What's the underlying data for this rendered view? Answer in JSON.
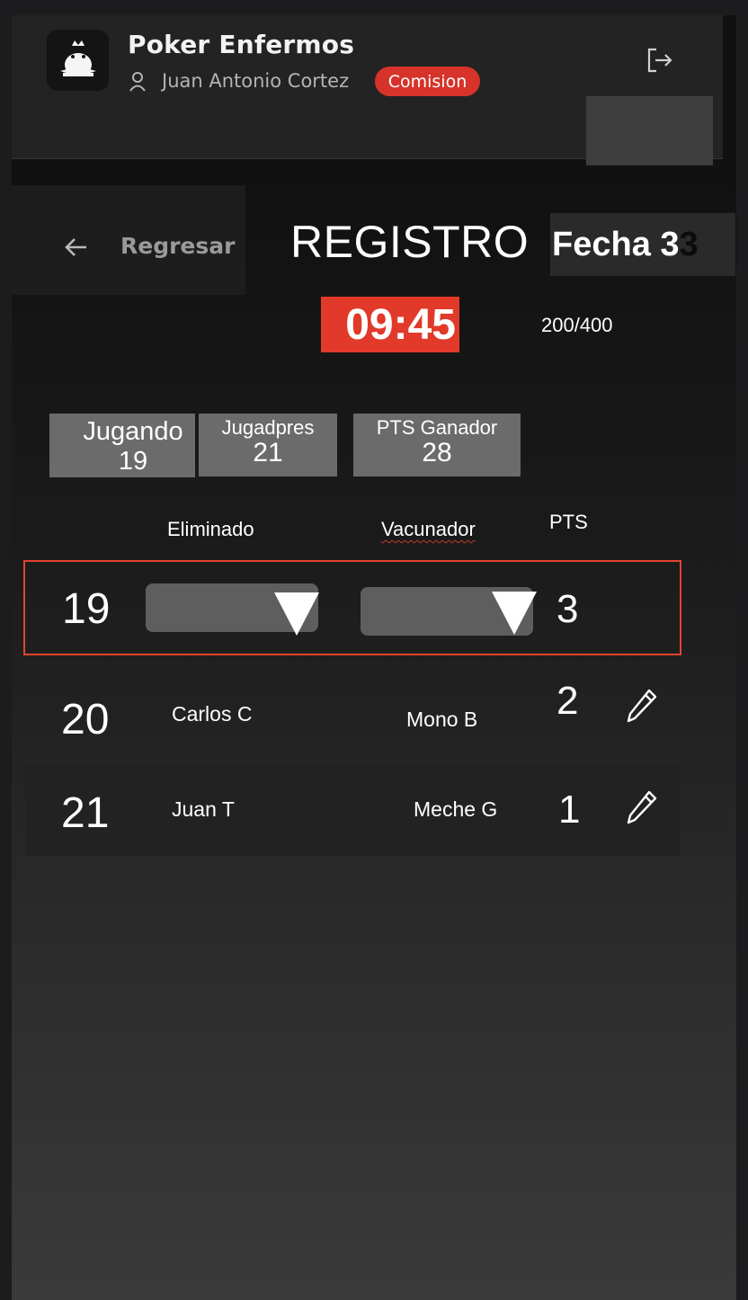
{
  "app": {
    "title": "Poker Enfermos",
    "user_name": "Juan Antonio Cortez",
    "role_badge": "Comision"
  },
  "nav": {
    "back_label": "Regresar"
  },
  "page": {
    "title": "REGISTRO",
    "fecha_label": "Fecha 3",
    "fecha_overflow": "3",
    "timer": "09:45",
    "blinds": "200/400"
  },
  "stats": {
    "jugando": {
      "label": "Jugando",
      "value": "19"
    },
    "jugadores": {
      "label": "Jugadpres",
      "value": "21"
    },
    "pts_ganador": {
      "label": "PTS Ganador",
      "value": "28"
    }
  },
  "table": {
    "headers": {
      "eliminado": "Eliminado",
      "vacunador": "Vacunador",
      "pts": "PTS"
    },
    "edit_row": {
      "position": "19",
      "eliminado": "",
      "vacunador": "",
      "pts": "3"
    },
    "rows": [
      {
        "position": "20",
        "eliminado": "Carlos C",
        "vacunador": "Mono B",
        "pts": "2"
      },
      {
        "position": "21",
        "eliminado": "Juan T",
        "vacunador": "Meche G",
        "pts": "1"
      }
    ]
  },
  "icons": {
    "logo": "crown-logo-icon",
    "user": "user-icon",
    "logout": "logout-icon",
    "back": "arrow-left-icon",
    "edit": "pencil-icon",
    "dropdown": "triangle-down-icon"
  },
  "colors": {
    "accent_red": "#e1392a",
    "badge_red": "#d7332a",
    "stat_gray": "#6b6b6b",
    "select_gray": "#5e5e5e"
  }
}
